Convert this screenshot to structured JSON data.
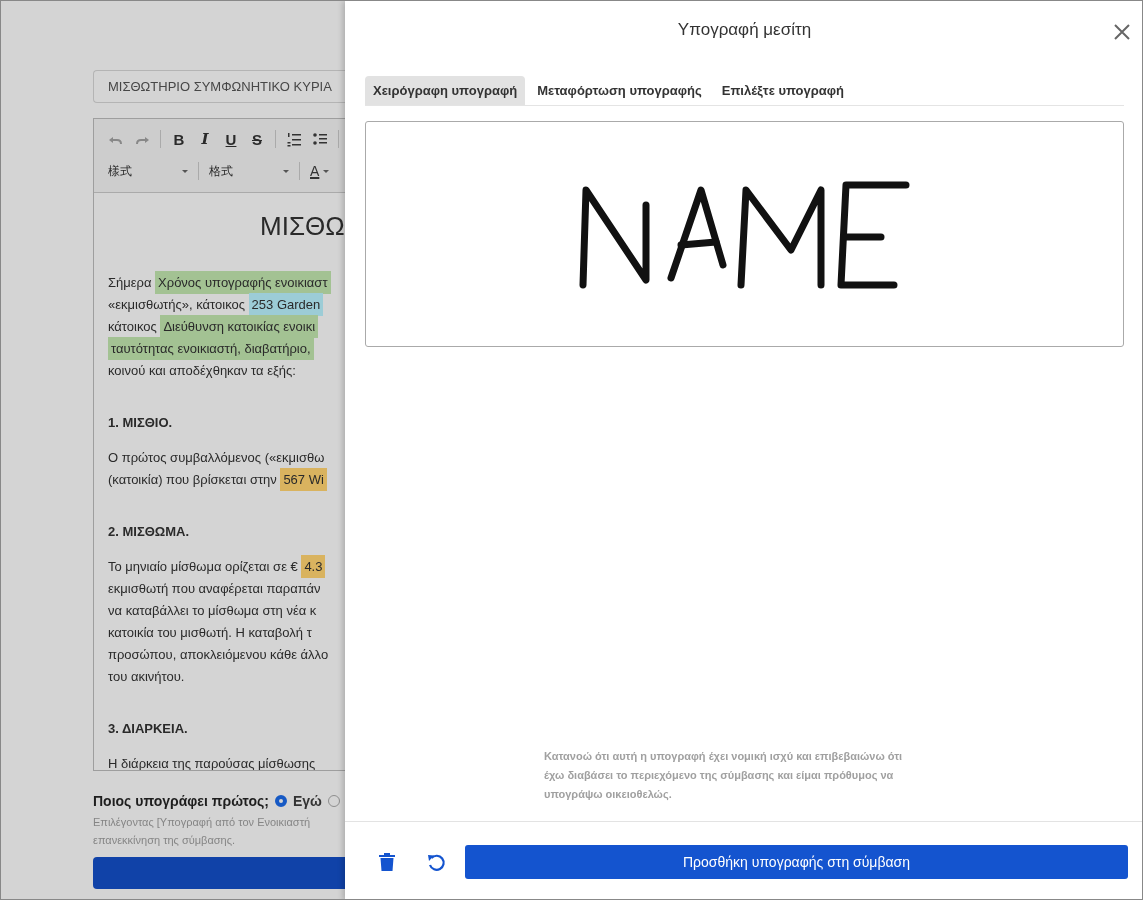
{
  "document": {
    "title_field": "ΜΙΣΘΩΤΗΡΙΟ ΣΥΜΦΩΝΗΤΙΚΟ ΚΥΡΙΑ",
    "format_buttons": [
      "B",
      "I",
      "U",
      "S"
    ],
    "dropdowns": [
      "樣式",
      "格式"
    ],
    "font_color_button": "A",
    "heading": "ΜΙΣΘΩ",
    "blocks": [
      {
        "kind": "para",
        "lines": [
          [
            {
              "text": "Σήμερα "
            },
            {
              "text": "Χρόνος υπογραφής ενοικιαστ",
              "color": "#a3c293"
            }
          ],
          [
            {
              "text": "«εκμισθωτής», κάτοικος "
            },
            {
              "text": "253 Garden",
              "color": "#9cccd6"
            }
          ],
          [
            {
              "text": "κάτοικος "
            },
            {
              "text": "Διεύθυνση κατοικίας ενοικι",
              "color": "#a3c293"
            }
          ],
          [
            {
              "text": "ταυτότητας ενοικιαστή, διαβατήριο,",
              "color": "#a3c293"
            }
          ],
          [
            {
              "text": "κοινού και αποδέχθηκαν τα εξής:"
            }
          ]
        ]
      },
      {
        "kind": "heading",
        "text": "1. ΜΙΣΘΙΟ."
      },
      {
        "kind": "para",
        "lines": [
          [
            {
              "text": "Ο πρώτος συμβαλλόμενος («εκμισθω"
            }
          ],
          [
            {
              "text": "(κατοικία) που βρίσκεται στην "
            },
            {
              "text": "567 Wi",
              "color": "#d9b35f"
            }
          ]
        ]
      },
      {
        "kind": "heading",
        "text": "2. ΜΙΣΘΩΜΑ."
      },
      {
        "kind": "para",
        "lines": [
          [
            {
              "text": "Το μηνιαίο μίσθωμα ορίζεται σε € "
            },
            {
              "text": "4.3",
              "color": "#d9b35f"
            }
          ],
          [
            {
              "text": "εκμισθωτή που αναφέρεται παραπάν"
            }
          ],
          [
            {
              "text": "να καταβάλλει το μίσθωμα στη νέα κ"
            }
          ],
          [
            {
              "text": "κατοικία του μισθωτή. Η καταβολή τ"
            }
          ],
          [
            {
              "text": "προσώπου, αποκλειόμενου κάθε άλλο"
            }
          ],
          [
            {
              "text": "του ακινήτου."
            }
          ]
        ]
      },
      {
        "kind": "heading",
        "text": "3. ΔΙΑΡΚΕΙΑ."
      },
      {
        "kind": "para",
        "lines": [
          [
            {
              "text": "Η διάρκεια της παρούσας μίσθωσης"
            }
          ]
        ]
      }
    ],
    "signer_question": "Ποιος υπογράφει πρώτος;",
    "signer_options": [
      {
        "label": "Εγώ",
        "selected": true
      },
      {
        "selected": false
      }
    ],
    "hint_lines": [
      "Επιλέγοντας [Υπογραφή από τον Ενοικιαστή",
      "επανεκκίνηση της σύμβασης."
    ]
  },
  "dialog": {
    "title": "Υπογραφή μεσίτη",
    "tabs": [
      {
        "label": "Χειρόγραφη υπογραφή",
        "selected": true
      },
      {
        "label": "Μεταφόρτωση υπογραφής",
        "selected": false
      },
      {
        "label": "Επιλέξτε υπογραφή",
        "selected": false
      }
    ],
    "disclaimer": "Κατανοώ ότι αυτή η υπογραφή έχει νομική ισχύ και επιβεβαιώνω ότι έχω διαβάσει το περιεχόμενο της σύμβασης και είμαι πρόθυμος να υπογράψω οικειοθελώς.",
    "submit_button": "Προσθήκη υπογραφής στη σύμβαση"
  }
}
